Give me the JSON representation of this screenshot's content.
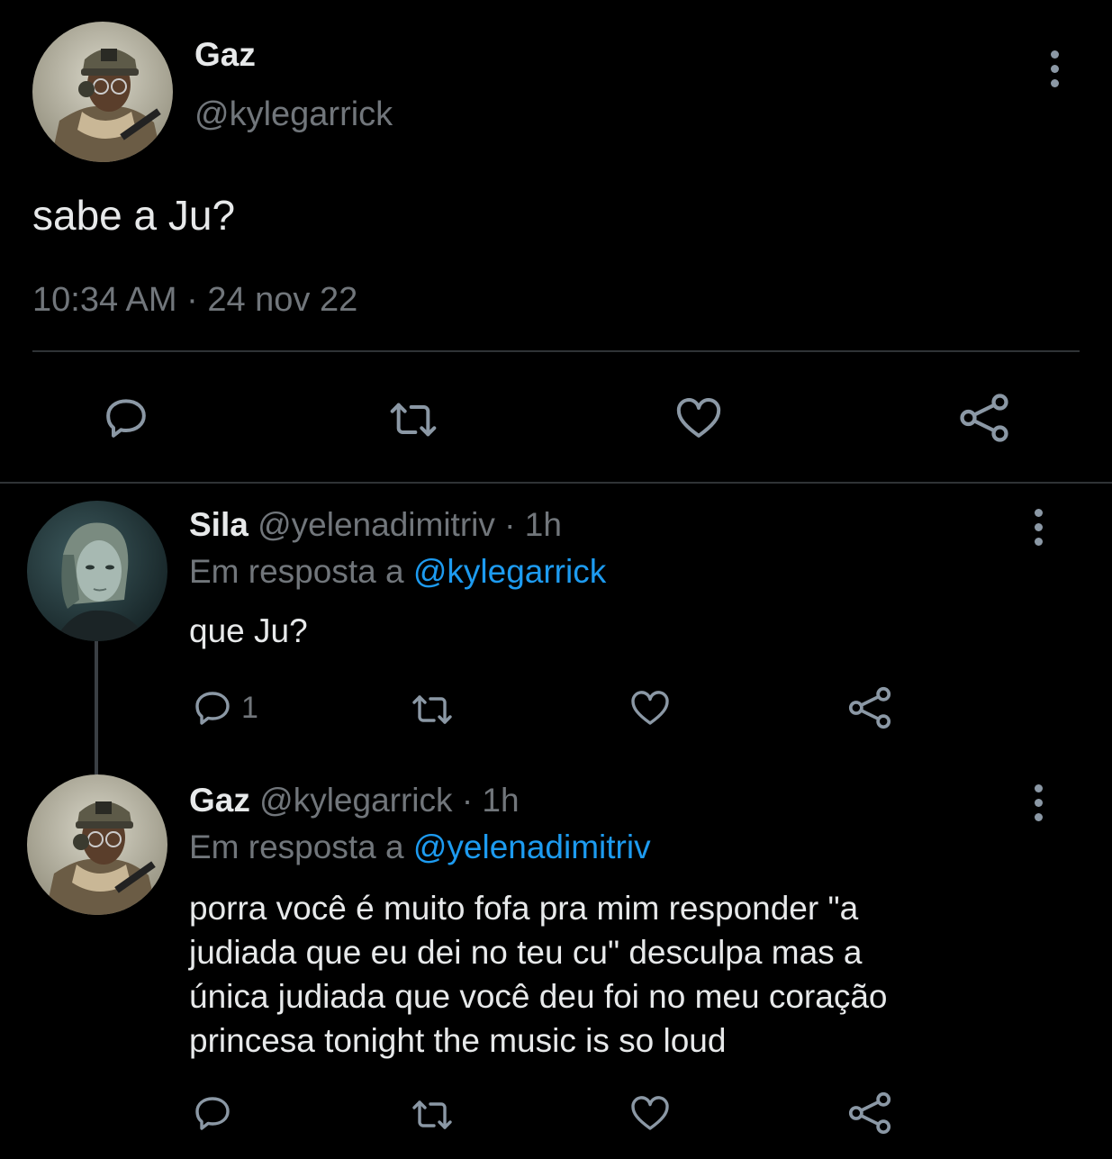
{
  "main_tweet": {
    "display_name": "Gaz",
    "handle": "@kylegarrick",
    "text": "sabe a Ju?",
    "timestamp": "10:34 AM · 24 nov 22",
    "avatar_icon": "soldier-avatar",
    "actions": [
      "reply-icon",
      "retweet-icon",
      "like-icon",
      "share-icon"
    ]
  },
  "replies": [
    {
      "display_name": "Sila",
      "handle": "@yelenadimitriv",
      "time": "· 1h",
      "reply_prefix": "Em resposta a",
      "reply_to": "@kylegarrick",
      "text": "que Ju?",
      "reply_count": "1",
      "avatar_icon": "woman-portrait-avatar"
    },
    {
      "display_name": "Gaz",
      "handle": "@kylegarrick",
      "time": "· 1h",
      "reply_prefix": "Em resposta a",
      "reply_to": "@yelenadimitriv",
      "text_lines": [
        "porra você é muito fofa pra mim responder \"a",
        "judiada que eu dei no teu cu\" desculpa mas a",
        "única judiada que você deu foi no meu coração",
        "princesa tonight the music is so loud"
      ],
      "avatar_icon": "soldier-avatar"
    }
  ],
  "colors": {
    "background": "#000000",
    "text": "#e7e9ea",
    "muted": "#71767b",
    "link": "#1d9bf0",
    "divider": "#2f3336"
  }
}
